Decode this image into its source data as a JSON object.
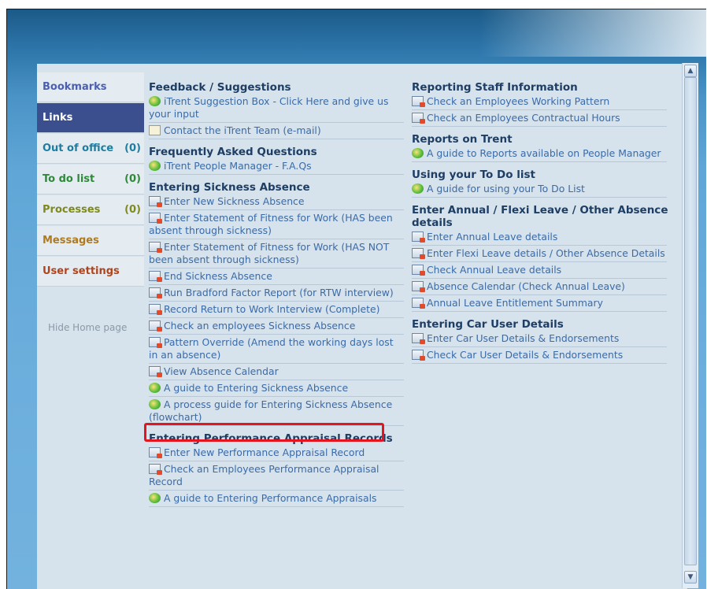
{
  "nav": {
    "items": [
      {
        "label": "Bookmarks",
        "count": "",
        "color": "#4a5fb2"
      },
      {
        "label": "Links",
        "count": "",
        "color": "#ffffff"
      },
      {
        "label": "Out of office",
        "count": "(0)",
        "color": "#1d7ea0"
      },
      {
        "label": "To do list",
        "count": "(0)",
        "color": "#2e8a3a"
      },
      {
        "label": "Processes",
        "count": "(0)",
        "color": "#7e8a1e"
      },
      {
        "label": "Messages",
        "count": "",
        "color": "#b07a1e"
      },
      {
        "label": "User settings",
        "count": "",
        "color": "#b0441c"
      }
    ],
    "hide_home": "Hide Home page"
  },
  "col1": {
    "sections": [
      {
        "title": "Feedback / Suggestions",
        "links": [
          {
            "icon": "globe-icon",
            "text": "iTrent Suggestion Box - Click Here and give us your input"
          },
          {
            "icon": "mail-icon",
            "text": "Contact the iTrent Team (e-mail)"
          }
        ]
      },
      {
        "title": "Frequently Asked Questions",
        "links": [
          {
            "icon": "globe-icon",
            "text": "iTrent People Manager - F.A.Qs"
          }
        ]
      },
      {
        "title": "Entering Sickness Absence",
        "links": [
          {
            "icon": "form-icon",
            "text": "Enter New Sickness Absence"
          },
          {
            "icon": "form-icon",
            "text": "Enter Statement of Fitness for Work (HAS been absent through sickness)"
          },
          {
            "icon": "form-icon",
            "text": "Enter Statement of Fitness for Work (HAS NOT been absent through sickness)"
          },
          {
            "icon": "form-icon",
            "text": "End Sickness Absence"
          },
          {
            "icon": "form-icon",
            "text": "Run Bradford Factor Report (for RTW interview)"
          },
          {
            "icon": "form-icon",
            "text": "Record Return to Work Interview (Complete)"
          },
          {
            "icon": "form-icon",
            "text": "Check an employees Sickness Absence"
          },
          {
            "icon": "form-icon",
            "text": "Pattern Override (Amend the working days lost in an absence)"
          },
          {
            "icon": "form-icon",
            "text": "View Absence Calendar"
          },
          {
            "icon": "globe-icon",
            "text": "A guide to Entering Sickness Absence"
          },
          {
            "icon": "globe-icon",
            "text": "A process guide for Entering Sickness Absence (flowchart)"
          }
        ]
      },
      {
        "title": "Entering Performance Appraisal Records",
        "links": [
          {
            "icon": "form-icon",
            "text": "Enter New Performance Appraisal Record"
          },
          {
            "icon": "form-icon",
            "text": "Check an Employees Performance Appraisal Record"
          },
          {
            "icon": "globe-icon",
            "text": "A guide to Entering Performance Appraisals"
          }
        ]
      }
    ]
  },
  "col2": {
    "sections": [
      {
        "title": "Reporting Staff Information",
        "links": [
          {
            "icon": "form-icon",
            "text": "Check an Employees Working Pattern"
          },
          {
            "icon": "form-icon",
            "text": "Check an Employees Contractual Hours"
          }
        ]
      },
      {
        "title": "Reports on Trent",
        "links": [
          {
            "icon": "globe-icon",
            "text": "A guide to Reports available on People Manager"
          }
        ]
      },
      {
        "title": "Using your To Do list",
        "links": [
          {
            "icon": "globe-icon",
            "text": "A guide for using your To Do List"
          }
        ]
      },
      {
        "title": "Enter Annual / Flexi Leave / Other Absence details",
        "links": [
          {
            "icon": "form-icon",
            "text": "Enter Annual Leave details"
          },
          {
            "icon": "form-icon",
            "text": "Enter Flexi Leave details / Other Absence Details"
          },
          {
            "icon": "form-icon",
            "text": "Check Annual Leave details"
          },
          {
            "icon": "form-icon",
            "text": "Absence Calendar (Check Annual Leave)"
          },
          {
            "icon": "form-icon",
            "text": "Annual Leave Entitlement Summary"
          }
        ]
      },
      {
        "title": "Entering Car User Details",
        "links": [
          {
            "icon": "form-icon",
            "text": "Enter Car User Details & Endorsements"
          },
          {
            "icon": "form-icon",
            "text": "Check Car User Details & Endorsements"
          }
        ]
      }
    ]
  },
  "scrollbar": {
    "up": "▲",
    "down": "▼"
  }
}
